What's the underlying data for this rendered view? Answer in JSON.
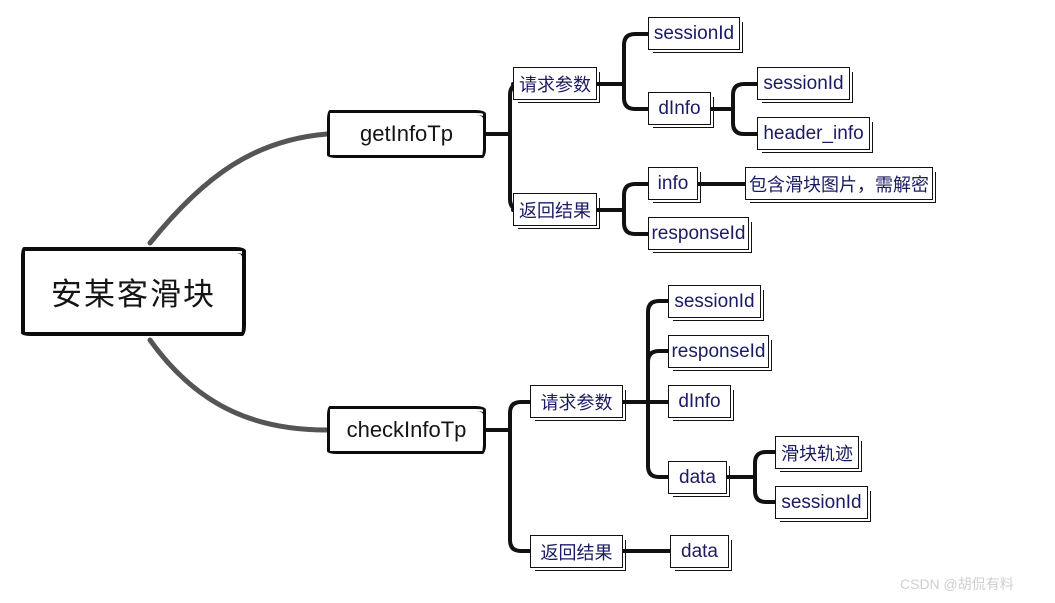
{
  "diagram": {
    "title": "安某客滑块",
    "watermark": "CSDN @胡侃有料",
    "colors": {
      "node_text": "#1b1b63",
      "root_text": "#151515",
      "edge_dark": "#111111",
      "edge_gray": "#555555",
      "watermark": "#cfcfcf",
      "background": "#ffffff"
    },
    "nodes": {
      "root": "安某客滑块",
      "get_info_tp": "getInfoTp",
      "check_info_tp": "checkInfoTp",
      "get_request_params": "请求参数",
      "get_request_session_id": "sessionId",
      "get_request_dinfo": "dInfo",
      "get_request_dinfo_session_id": "sessionId",
      "get_request_dinfo_header_info": "header_info",
      "get_result": "返回结果",
      "get_result_info": "info",
      "get_result_info_note": "包含滑块图片，需解密",
      "get_result_response_id": "responseId",
      "check_request_params": "请求参数",
      "check_request_session_id": "sessionId",
      "check_request_response_id": "responseId",
      "check_request_dinfo": "dInfo",
      "check_request_data": "data",
      "check_request_data_track": "滑块轨迹",
      "check_request_data_session_id": "sessionId",
      "check_result": "返回结果",
      "check_result_data": "data"
    }
  }
}
